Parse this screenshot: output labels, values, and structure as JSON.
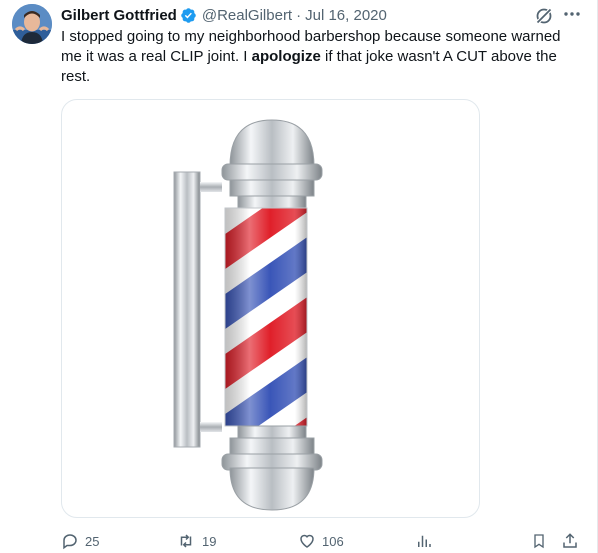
{
  "tweet": {
    "author_name": "Gilbert Gottfried",
    "handle": "@RealGilbert",
    "separator": "·",
    "date": "Jul 16, 2020",
    "text_part1": "I stopped going to my neighborhood barbershop because someone warned me it was a real CLIP joint.  I ",
    "text_bold": "apologize",
    "text_part2": " if that joke wasn't A CUT above the rest.",
    "media_description_icon": "barber-pole-image"
  },
  "actions": {
    "replies": "25",
    "retweets": "19",
    "likes": "106"
  },
  "colors": {
    "text": "#0f1419",
    "secondary": "#536471",
    "verified": "#1d9bf0",
    "pole_red": "#e0202a",
    "pole_blue": "#3a56b8"
  }
}
